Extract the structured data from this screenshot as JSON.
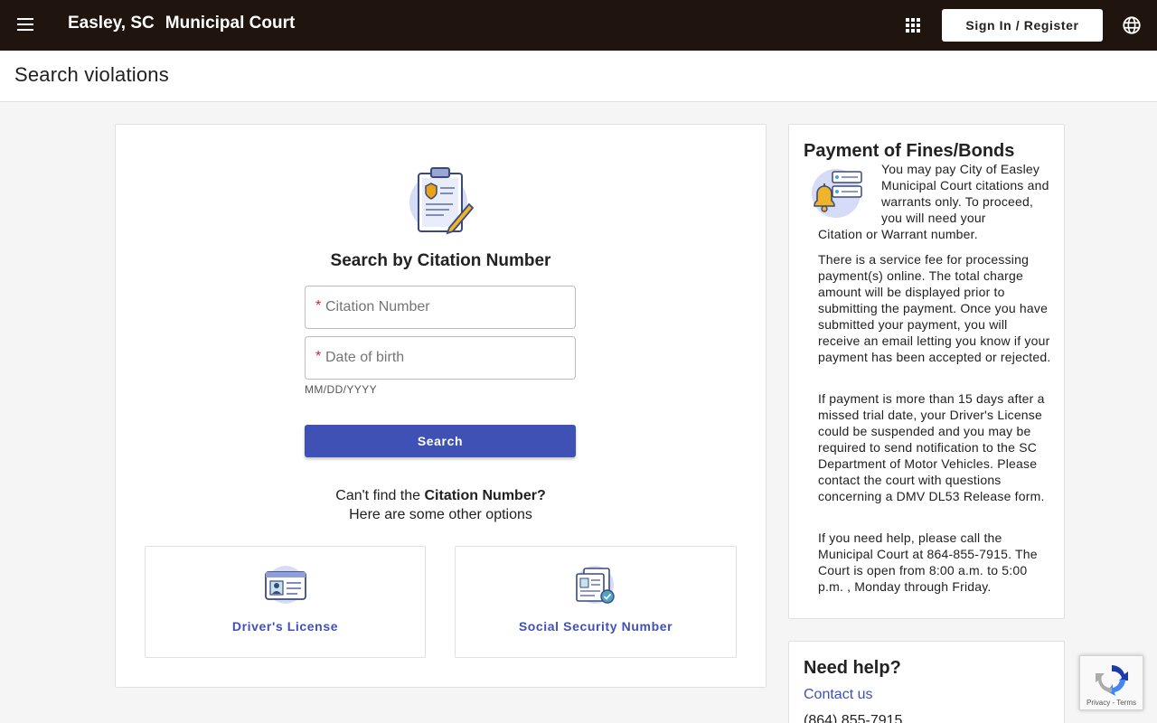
{
  "header": {
    "city": "Easley, SC",
    "court": "Municipal Court",
    "signin_label": "Sign In / Register",
    "icons": [
      "menu-icon",
      "apps-grid-icon",
      "globe-icon"
    ],
    "background_color": "#1f150e"
  },
  "page": {
    "title": "Search violations"
  },
  "search": {
    "heading": "Search by Citation Number",
    "citation_placeholder": "Citation Number",
    "dob_placeholder": "Date of birth",
    "required_marker": "*",
    "dob_hint": "MM/DD/YYYY",
    "button_label": "Search",
    "button_color": "#3f51b5"
  },
  "alternatives": {
    "cant_find_prefix": "Can't find the",
    "cant_find_bold": "Citation Number?",
    "other_options": "Here are some other options",
    "options": [
      {
        "label": "Driver's License",
        "icon": "id-card-icon"
      },
      {
        "label": "Social Security Number",
        "icon": "ssn-document-icon"
      }
    ]
  },
  "payment": {
    "title": "Payment of Fines/Bonds",
    "para1_a": "You may pay City of Easley Municipal Court citations and warrants only. To proceed, you will need your",
    "para1_b": "Citation or Warrant number.",
    "para2": "There is a service fee for processing payment(s) online. The total charge amount will be displayed prior to submitting the payment. Once you have submitted your payment, you will receive an email letting you know if your payment has been accepted or rejected.",
    "para3": "If payment is more than 15 days after a missed trial date, your Driver's License could be suspended and you may be required to send notification to the SC Department of Motor Vehicles. Please contact the court with questions concerning a DMV DL53 Release form.",
    "para4": "If you need help, please call the Municipal Court at 864-855-7915. The Court is open from 8:00 a.m. to 5:00 p.m. , Monday through Friday."
  },
  "help": {
    "title": "Need help?",
    "contact_label": "Contact us",
    "phone": "(864) 855-7915"
  },
  "recaptcha": {
    "links": "Privacy - Terms"
  }
}
